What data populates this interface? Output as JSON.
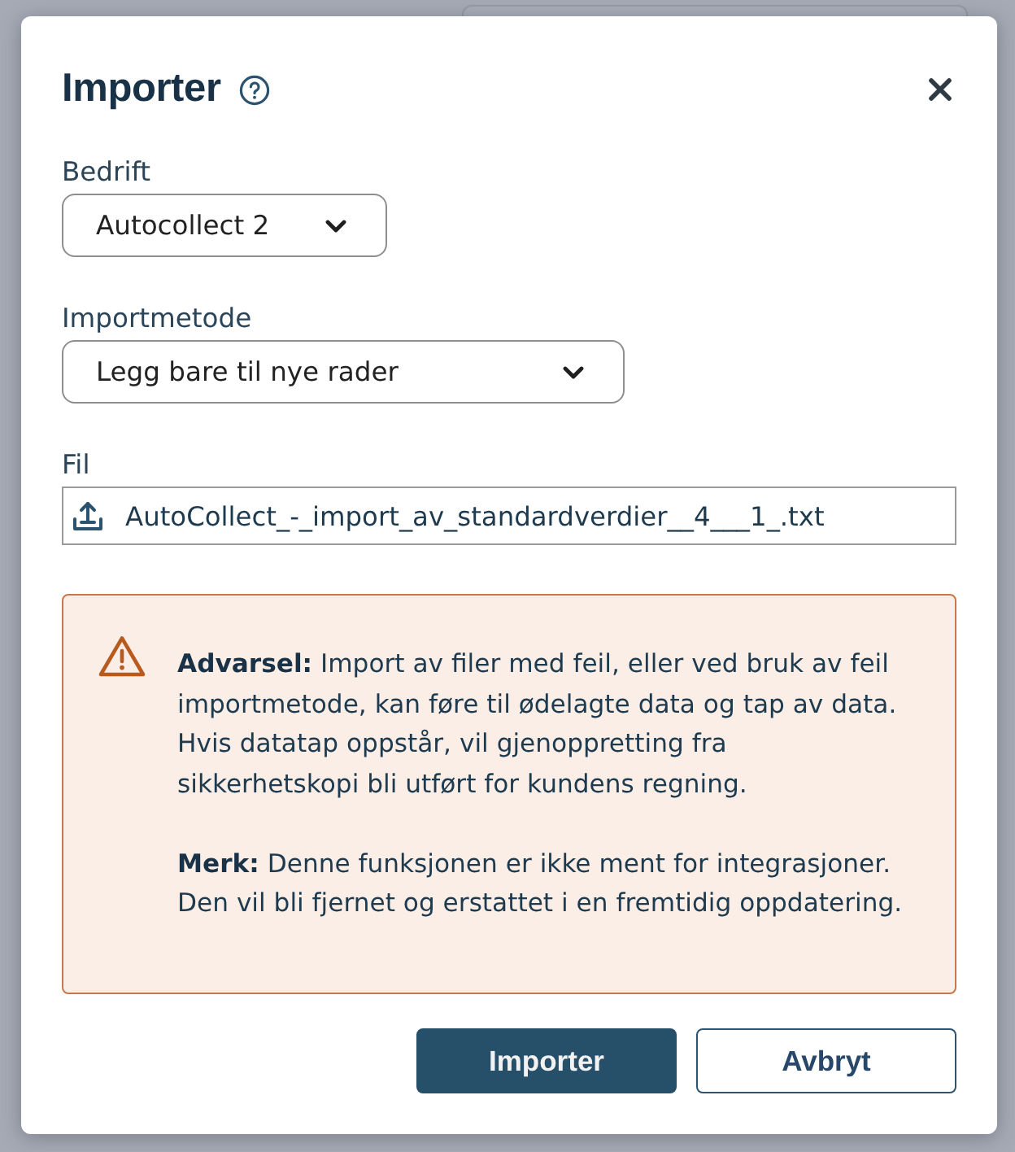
{
  "dialog": {
    "title": "Importer",
    "fields": [
      {
        "kind": "select",
        "label": "Bedrift",
        "value": "Autocollect 2"
      },
      {
        "kind": "select",
        "label": "Importmetode",
        "value": "Legg bare til nye rader"
      },
      {
        "kind": "file",
        "label": "Fil",
        "value": "AutoCollect_-_import_av_standardverdier__4___1_.txt"
      }
    ],
    "warning": {
      "paragraphs": [
        "**Advarsel:** Import av filer med feil, eller ved bruk av feil importmetode, kan føre til ødelagte data og tap av data. Hvis datatap oppstår, vil gjenoppretting fra sikkerhetskopi bli utført for kundens regning.",
        "**Merk:** Denne funksjonen er ikke ment for integrasjoner. Den vil bli fjernet og erstattet i en fremtidig oppdatering."
      ]
    },
    "buttons": [
      {
        "kind": "primary",
        "label": "Importer"
      },
      {
        "kind": "secondary",
        "label": "Avbryt"
      }
    ]
  }
}
